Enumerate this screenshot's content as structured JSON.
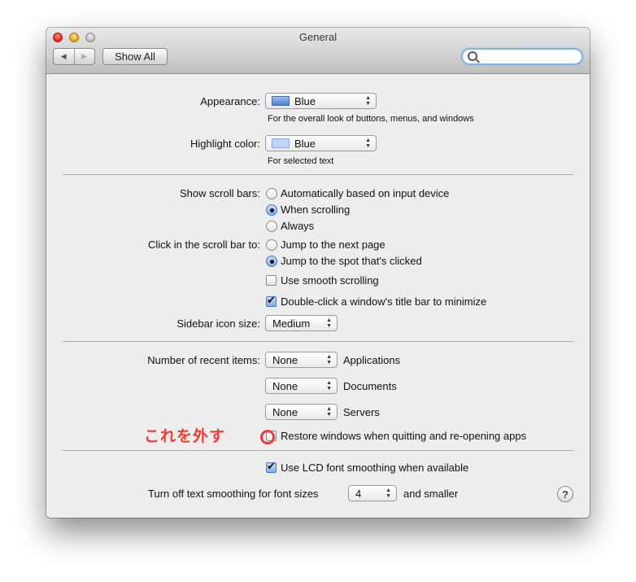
{
  "window": {
    "title": "General",
    "show_all_label": "Show All",
    "search_placeholder": "",
    "nav_back": "◀",
    "nav_forward": "▶"
  },
  "appearance": {
    "label": "Appearance:",
    "value": "Blue",
    "hint": "For the overall look of buttons, menus, and windows"
  },
  "highlight": {
    "label": "Highlight color:",
    "value": "Blue",
    "hint": "For selected text"
  },
  "scroll_bars": {
    "label": "Show scroll bars:",
    "options": [
      "Automatically based on input device",
      "When scrolling",
      "Always"
    ],
    "selected": "When scrolling"
  },
  "click_scroll": {
    "label": "Click in the scroll bar to:",
    "options": [
      "Jump to the next page",
      "Jump to the spot that's clicked"
    ],
    "selected": "Jump to the spot that's clicked"
  },
  "smooth_scrolling": {
    "label": "Use smooth scrolling",
    "checked": false
  },
  "double_click": {
    "label": "Double-click a window's title bar to minimize",
    "checked": true
  },
  "sidebar": {
    "label": "Sidebar icon size:",
    "value": "Medium"
  },
  "recent_items": {
    "label": "Number of recent items:",
    "rows": [
      {
        "value": "None",
        "kind": "Applications"
      },
      {
        "value": "None",
        "kind": "Documents"
      },
      {
        "value": "None",
        "kind": "Servers"
      }
    ]
  },
  "restore_windows": {
    "label": "Restore windows when quitting and re-opening apps",
    "checked": false
  },
  "annotation": {
    "text": "これを外す",
    "color": "#ef3b36"
  },
  "lcd": {
    "label": "Use LCD font smoothing when available",
    "checked": true
  },
  "text_smoothing": {
    "label": "Turn off text smoothing for font sizes",
    "value": "4",
    "suffix": "and smaller"
  },
  "help": {
    "label": "?"
  }
}
